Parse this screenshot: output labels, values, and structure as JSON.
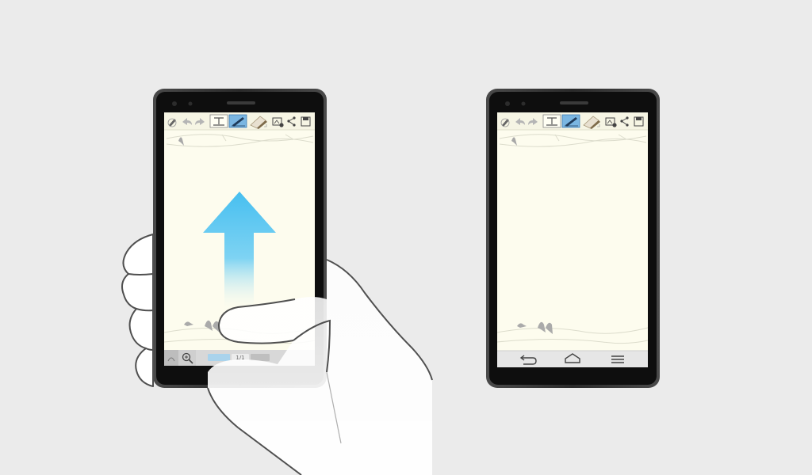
{
  "colors": {
    "background": "#ebebeb",
    "phone_frame": "#2b2b2b",
    "phone_bezel": "#0d0d0d",
    "screen_bg": "#fdfcee",
    "toolbar_bg": "#f7f6e6",
    "arrow_top": "#4ec3ef",
    "hand_fill": "#ffffff",
    "hand_stroke": "#555555",
    "navbar_bg": "#e9e9e9"
  },
  "left_phone": {
    "toolbar_icons": [
      "pen-settings-icon",
      "undo-icon",
      "redo-icon",
      "text-mode-icon",
      "pen-mode-icon",
      "eraser-icon",
      "insert-image-icon",
      "share-icon",
      "save-icon"
    ],
    "bottom_bar": {
      "page_indicator": "1/1",
      "icons": [
        "collapse-icon",
        "zoom-icon"
      ]
    },
    "gesture": "swipe-up-arrow"
  },
  "right_phone": {
    "toolbar_icons": [
      "pen-settings-icon",
      "undo-icon",
      "redo-icon",
      "text-mode-icon",
      "pen-mode-icon",
      "eraser-icon",
      "insert-image-icon",
      "share-icon",
      "save-icon"
    ],
    "nav_bar": [
      "back-icon",
      "home-icon",
      "menu-icon"
    ]
  }
}
